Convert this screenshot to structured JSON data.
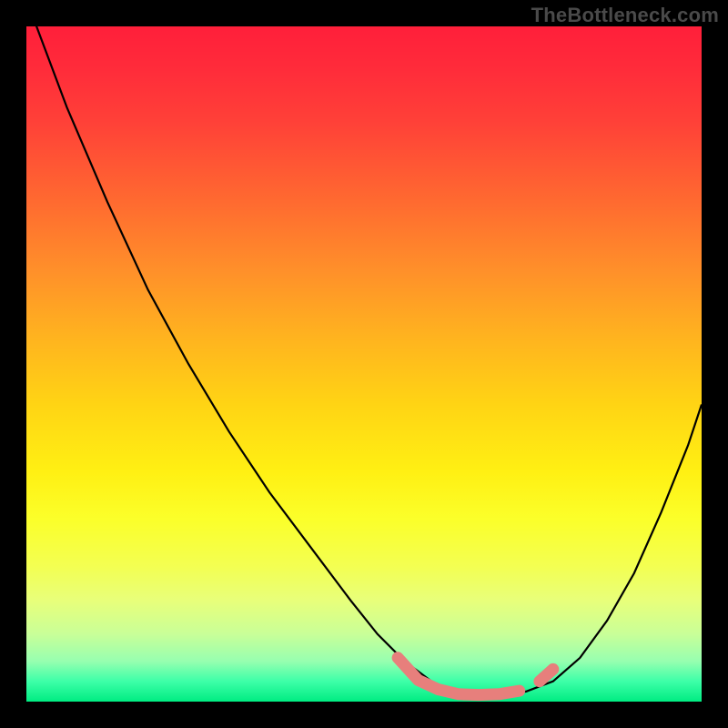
{
  "watermark": "TheBottleneck.com",
  "colors": {
    "background": "#000000",
    "curve": "#000000",
    "marker": "#e77f7c",
    "gradient_top": "#ff1f3a",
    "gradient_bottom": "#00ec82"
  },
  "chart_data": {
    "type": "line",
    "title": "",
    "xlabel": "",
    "ylabel": "",
    "xlim": [
      0,
      100
    ],
    "ylim": [
      0,
      100
    ],
    "grid": false,
    "legend": false,
    "annotations": [
      "TheBottleneck.com"
    ],
    "series": [
      {
        "name": "bottleneck-curve",
        "x": [
          0,
          6,
          12,
          18,
          24,
          30,
          36,
          42,
          48,
          52,
          56,
          60,
          63,
          66,
          70,
          74,
          78,
          82,
          86,
          90,
          94,
          98,
          100
        ],
        "y": [
          104,
          88,
          74,
          61,
          50,
          40,
          31,
          23,
          15,
          10,
          6,
          3,
          1.5,
          1,
          1,
          1.5,
          3,
          6.5,
          12,
          19,
          28,
          38,
          44
        ]
      },
      {
        "name": "optimum-marker",
        "x": [
          55,
          58,
          61,
          64,
          67,
          70,
          73,
          76,
          78
        ],
        "y": [
          6.5,
          3.2,
          1.8,
          1.1,
          1.0,
          1.1,
          1.6,
          3.0,
          4.8
        ]
      }
    ]
  }
}
